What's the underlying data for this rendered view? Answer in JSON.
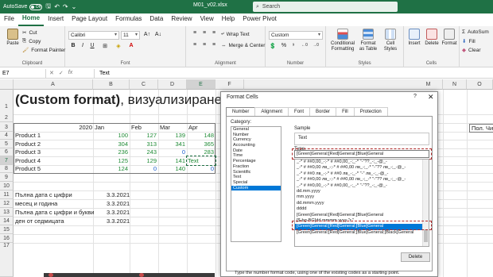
{
  "titlebar": {
    "autosave_label": "AutoSave",
    "autosave_state": "Off",
    "doc_title": "M01_v02.xlsx",
    "search_placeholder": "Search"
  },
  "menu": {
    "tabs": [
      "File",
      "Home",
      "Insert",
      "Page Layout",
      "Formulas",
      "Data",
      "Review",
      "View",
      "Help",
      "Power Pivot"
    ],
    "active": "Home"
  },
  "ribbon": {
    "paste": "Paste",
    "cut": "Cut",
    "copy": "Copy",
    "format_painter": "Format Painter",
    "clipboard": "Clipboard",
    "font_name": "Calibri",
    "font_size": "11",
    "font": "Font",
    "wrap_text": "Wrap Text",
    "merge_center": "Merge & Center",
    "alignment": "Alignment",
    "number_format": "Custom",
    "number": "Number",
    "conditional_formatting": "Conditional Formatting",
    "format_as_table": "Format as Table",
    "cell_styles": "Cell Styles",
    "styles": "Styles",
    "insert": "Insert",
    "delete": "Delete",
    "format": "Format",
    "cells": "Cells",
    "autosum": "AutoSum",
    "fill": "Fill",
    "clear": "Clear"
  },
  "formula_bar": {
    "name_box": "E7",
    "content": "Text"
  },
  "columns": [
    "A",
    "B",
    "C",
    "D",
    "E",
    "F",
    "M",
    "N",
    "O"
  ],
  "rows": [
    "1",
    "2",
    "3",
    "4",
    "5",
    "6",
    "7",
    "8",
    "9",
    "10",
    "11",
    "12",
    "13",
    "14",
    "15",
    "16",
    "17"
  ],
  "sheet": {
    "title_bold": "(Custom format)",
    "title_rest": ", визуализиране на",
    "year": "2020",
    "months": [
      "Jan",
      "Feb",
      "Mar",
      "Apr"
    ],
    "products": [
      {
        "name": "Product 1",
        "values": [
          "100",
          "127",
          "139",
          "148"
        ]
      },
      {
        "name": "Product 2",
        "values": [
          "304",
          "313",
          "341",
          "365"
        ]
      },
      {
        "name": "Product 3",
        "values": [
          "236",
          "243",
          "0",
          "283"
        ]
      },
      {
        "name": "Product 4",
        "values": [
          "125",
          "129",
          "141",
          "Text"
        ]
      },
      {
        "name": "Product 5",
        "values": [
          "124",
          "0",
          "140",
          "0"
        ]
      }
    ],
    "right_header": "Пол. Чис",
    "dates": [
      {
        "label": "Пълна дата с цифри",
        "value": "3.3.2021"
      },
      {
        "label": "месец и година",
        "value": "3.3.2021"
      },
      {
        "label": "Пълна дата с цифри и букви",
        "value": "3.3.2021"
      },
      {
        "label": "ден от седмицата",
        "value": "3.3.2021"
      }
    ]
  },
  "dialog": {
    "title": "Format Cells",
    "help": "?",
    "tabs": [
      "Number",
      "Alignment",
      "Font",
      "Border",
      "Fill",
      "Protection"
    ],
    "active_tab": "Number",
    "category_label": "Category:",
    "categories": [
      "General",
      "Number",
      "Currency",
      "Accounting",
      "Date",
      "Time",
      "Percentage",
      "Fraction",
      "Scientific",
      "Text",
      "Special",
      "Custom"
    ],
    "selected_category": "Custom",
    "sample_label": "Sample",
    "sample_value": "Text",
    "type_label": "Type:",
    "type_value": "[Green]General;[Red]General;[Blue]General",
    "format_list": [
      "_-* # ##0,00_-;-* # ##0,00_-;_-* \"-\"??_-;_-@_-",
      "_-* # ##0,00 лв_-;-* # ##0,00 лв_-;_-* \"-\"?? лв_-;_-@_-",
      "_-* # ##0 лв_-;-* # ##0 лв_-;_-* \"-\" лв_-;_-@_-",
      "_-* # ##0,00 лв_-;-* # ##0,00 лв_-;_-* \"-\"?? лв_-;_-@_-",
      "_-* # ##0,00_-;-* # ##0,00_-;_-* \"-\"??_-;_-@_-",
      "dd.mm.yyyy",
      "mm.yyyy",
      "dd.mmm.yyyy",
      "dddd",
      "[Green]General;[Red]General;[Blue]General",
      "[$-bg-BG]dd mmmm yyyy \"г.\"",
      "[Green]General;[Red]General;[Blue]General",
      "[Green]General;[Red]General;[Blue]General;[Black]General"
    ],
    "selected_format_index": 11,
    "delete": "Delete",
    "hint": "Type the number format code, using one of the existing codes as a starting point."
  }
}
